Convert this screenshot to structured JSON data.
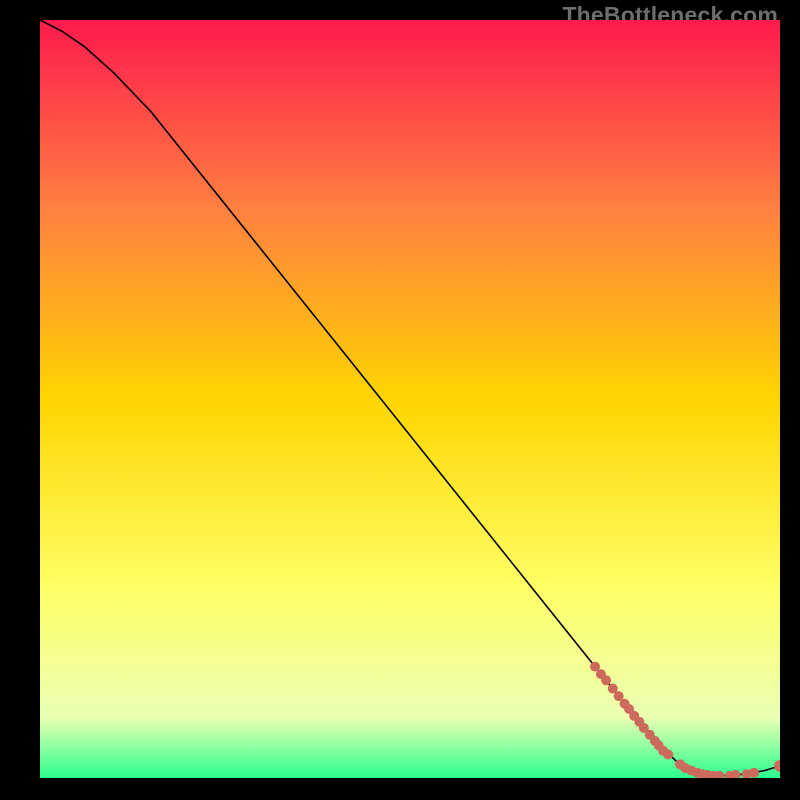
{
  "watermark": "TheBottleneck.com",
  "chart_data": {
    "type": "line",
    "title": "",
    "xlabel": "",
    "ylabel": "",
    "xlim": [
      0,
      100
    ],
    "ylim": [
      0,
      100
    ],
    "background_gradient": {
      "top": "#ff1a4d",
      "mid_upper": "#ff8040",
      "mid": "#ffd500",
      "mid_lower": "#ffff66",
      "lower": "#eaffb3",
      "bottom": "#2bff8f"
    },
    "curve": [
      {
        "x": 0.0,
        "y": 100.0
      },
      {
        "x": 3.0,
        "y": 98.5
      },
      {
        "x": 6.0,
        "y": 96.5
      },
      {
        "x": 10.0,
        "y": 93.0
      },
      {
        "x": 15.0,
        "y": 87.9
      },
      {
        "x": 20.0,
        "y": 81.8
      },
      {
        "x": 30.0,
        "y": 69.6
      },
      {
        "x": 40.0,
        "y": 57.4
      },
      {
        "x": 50.0,
        "y": 45.2
      },
      {
        "x": 60.0,
        "y": 33.0
      },
      {
        "x": 70.0,
        "y": 20.8
      },
      {
        "x": 75.0,
        "y": 14.7
      },
      {
        "x": 80.0,
        "y": 8.6
      },
      {
        "x": 83.0,
        "y": 5.0
      },
      {
        "x": 86.0,
        "y": 2.2
      },
      {
        "x": 88.0,
        "y": 1.0
      },
      {
        "x": 90.0,
        "y": 0.4
      },
      {
        "x": 93.0,
        "y": 0.3
      },
      {
        "x": 96.0,
        "y": 0.6
      },
      {
        "x": 98.0,
        "y": 1.0
      },
      {
        "x": 100.0,
        "y": 1.6
      }
    ],
    "markers": [
      {
        "x": 75.0,
        "y": 14.7
      },
      {
        "x": 75.8,
        "y": 13.7
      },
      {
        "x": 76.5,
        "y": 12.9
      },
      {
        "x": 77.4,
        "y": 11.8
      },
      {
        "x": 78.2,
        "y": 10.8
      },
      {
        "x": 79.0,
        "y": 9.8
      },
      {
        "x": 79.6,
        "y": 9.1
      },
      {
        "x": 80.3,
        "y": 8.2
      },
      {
        "x": 81.0,
        "y": 7.4
      },
      {
        "x": 81.6,
        "y": 6.6
      },
      {
        "x": 82.4,
        "y": 5.7
      },
      {
        "x": 83.1,
        "y": 4.9
      },
      {
        "x": 83.6,
        "y": 4.3
      },
      {
        "x": 84.2,
        "y": 3.6
      },
      {
        "x": 84.9,
        "y": 3.1
      },
      {
        "x": 86.5,
        "y": 1.8
      },
      {
        "x": 87.2,
        "y": 1.3
      },
      {
        "x": 88.0,
        "y": 1.0
      },
      {
        "x": 88.8,
        "y": 0.7
      },
      {
        "x": 89.5,
        "y": 0.5
      },
      {
        "x": 90.2,
        "y": 0.4
      },
      {
        "x": 91.0,
        "y": 0.3
      },
      {
        "x": 91.8,
        "y": 0.3
      },
      {
        "x": 93.2,
        "y": 0.3
      },
      {
        "x": 94.0,
        "y": 0.4
      },
      {
        "x": 95.5,
        "y": 0.5
      },
      {
        "x": 96.5,
        "y": 0.7
      },
      {
        "x": 100.0,
        "y": 1.6
      }
    ],
    "marker_style": {
      "color": "#cc6a5b",
      "radius_small": 5,
      "radius_end": 6
    }
  }
}
